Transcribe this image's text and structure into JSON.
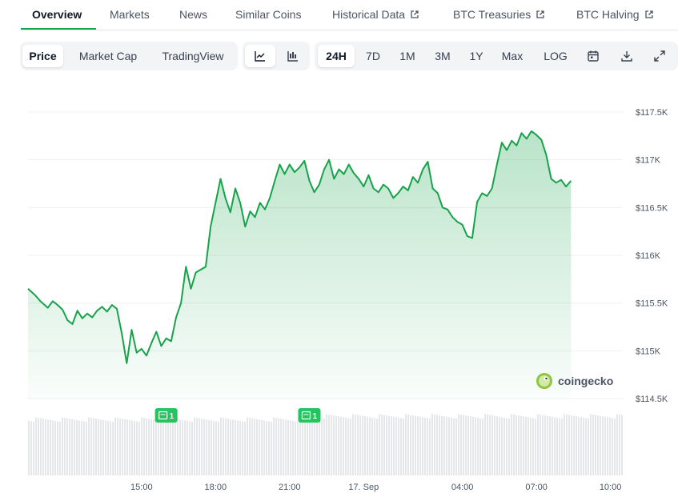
{
  "nav": {
    "tabs": [
      {
        "label": "Overview",
        "active": true
      },
      {
        "label": "Markets"
      },
      {
        "label": "News"
      },
      {
        "label": "Similar Coins"
      },
      {
        "label": "Historical Data",
        "external": true
      },
      {
        "label": "BTC Treasuries",
        "external": true
      },
      {
        "label": "BTC Halving",
        "external": true
      }
    ]
  },
  "toolbar": {
    "metric_buttons": [
      {
        "label": "Price",
        "selected": true
      },
      {
        "label": "Market Cap"
      },
      {
        "label": "TradingView"
      }
    ],
    "chart_type_icons": [
      "line-chart-icon",
      "candlestick-chart-icon"
    ],
    "range_buttons": [
      {
        "label": "24H",
        "selected": true
      },
      {
        "label": "7D"
      },
      {
        "label": "1M"
      },
      {
        "label": "3M"
      },
      {
        "label": "1Y"
      },
      {
        "label": "Max"
      },
      {
        "label": "LOG"
      }
    ],
    "action_icons": [
      "calendar-icon",
      "download-icon",
      "fullscreen-icon"
    ]
  },
  "watermark": "coingecko",
  "colors": {
    "accent": "#16a34a",
    "line": "#16a34a",
    "badge": "#22c55e",
    "volume": "#e5e7eb"
  },
  "chart_data": {
    "type": "area",
    "xlabel": "",
    "ylabel": "",
    "yticks": [
      "$114.5K",
      "$115K",
      "$115.5K",
      "$116K",
      "$116.5K",
      "$117K",
      "$117.5K"
    ],
    "ylim": [
      114500,
      117500
    ],
    "xticks": [
      "15:00",
      "18:00",
      "21:00",
      "17. Sep",
      "04:00",
      "07:00",
      "10:00"
    ],
    "xtick_hours": [
      15,
      18,
      21,
      24,
      28,
      31,
      34
    ],
    "xlim_hours": [
      10.4,
      34.5
    ],
    "grid": true,
    "legend": "none",
    "price_points": [
      [
        10.4,
        115650
      ],
      [
        10.7,
        115580
      ],
      [
        10.9,
        115520
      ],
      [
        11.2,
        115450
      ],
      [
        11.4,
        115520
      ],
      [
        11.6,
        115480
      ],
      [
        11.8,
        115430
      ],
      [
        12.0,
        115320
      ],
      [
        12.2,
        115280
      ],
      [
        12.4,
        115420
      ],
      [
        12.6,
        115340
      ],
      [
        12.8,
        115390
      ],
      [
        13.0,
        115350
      ],
      [
        13.2,
        115420
      ],
      [
        13.4,
        115460
      ],
      [
        13.6,
        115410
      ],
      [
        13.8,
        115480
      ],
      [
        14.0,
        115440
      ],
      [
        14.2,
        115180
      ],
      [
        14.4,
        114870
      ],
      [
        14.6,
        115220
      ],
      [
        14.8,
        114980
      ],
      [
        15.0,
        115020
      ],
      [
        15.2,
        114950
      ],
      [
        15.4,
        115080
      ],
      [
        15.6,
        115200
      ],
      [
        15.8,
        115050
      ],
      [
        16.0,
        115130
      ],
      [
        16.2,
        115100
      ],
      [
        16.4,
        115350
      ],
      [
        16.6,
        115500
      ],
      [
        16.8,
        115880
      ],
      [
        17.0,
        115650
      ],
      [
        17.2,
        115820
      ],
      [
        17.4,
        115850
      ],
      [
        17.6,
        115880
      ],
      [
        17.8,
        116300
      ],
      [
        18.0,
        116550
      ],
      [
        18.2,
        116800
      ],
      [
        18.4,
        116600
      ],
      [
        18.6,
        116450
      ],
      [
        18.8,
        116700
      ],
      [
        19.0,
        116550
      ],
      [
        19.2,
        116300
      ],
      [
        19.4,
        116460
      ],
      [
        19.6,
        116400
      ],
      [
        19.8,
        116550
      ],
      [
        20.0,
        116480
      ],
      [
        20.2,
        116600
      ],
      [
        20.4,
        116780
      ],
      [
        20.6,
        116950
      ],
      [
        20.8,
        116850
      ],
      [
        21.0,
        116950
      ],
      [
        21.2,
        116870
      ],
      [
        21.4,
        116920
      ],
      [
        21.6,
        116990
      ],
      [
        21.8,
        116780
      ],
      [
        22.0,
        116660
      ],
      [
        22.2,
        116740
      ],
      [
        22.4,
        116900
      ],
      [
        22.6,
        117000
      ],
      [
        22.8,
        116800
      ],
      [
        23.0,
        116900
      ],
      [
        23.2,
        116850
      ],
      [
        23.4,
        116950
      ],
      [
        23.6,
        116860
      ],
      [
        23.8,
        116800
      ],
      [
        24.0,
        116720
      ],
      [
        24.2,
        116840
      ],
      [
        24.4,
        116700
      ],
      [
        24.6,
        116660
      ],
      [
        24.8,
        116740
      ],
      [
        25.0,
        116700
      ],
      [
        25.2,
        116600
      ],
      [
        25.4,
        116650
      ],
      [
        25.6,
        116720
      ],
      [
        25.8,
        116680
      ],
      [
        26.0,
        116820
      ],
      [
        26.2,
        116760
      ],
      [
        26.4,
        116900
      ],
      [
        26.6,
        116980
      ],
      [
        26.8,
        116700
      ],
      [
        27.0,
        116650
      ],
      [
        27.2,
        116500
      ],
      [
        27.4,
        116480
      ],
      [
        27.6,
        116400
      ],
      [
        27.8,
        116350
      ],
      [
        28.0,
        116320
      ],
      [
        28.2,
        116200
      ],
      [
        28.4,
        116180
      ],
      [
        28.6,
        116560
      ],
      [
        28.8,
        116650
      ],
      [
        29.0,
        116620
      ],
      [
        29.2,
        116700
      ],
      [
        29.4,
        116950
      ],
      [
        29.6,
        117180
      ],
      [
        29.8,
        117100
      ],
      [
        30.0,
        117200
      ],
      [
        30.2,
        117150
      ],
      [
        30.4,
        117280
      ],
      [
        30.6,
        117220
      ],
      [
        30.8,
        117300
      ],
      [
        31.0,
        117260
      ],
      [
        31.2,
        117210
      ],
      [
        31.4,
        117050
      ],
      [
        31.6,
        116800
      ],
      [
        31.8,
        116760
      ],
      [
        32.0,
        116790
      ],
      [
        32.2,
        116720
      ],
      [
        32.4,
        116780
      ]
    ],
    "volume_level": 0.85,
    "news_badges": [
      {
        "hour": 16.0,
        "label": "1"
      },
      {
        "hour": 21.8,
        "label": "1"
      }
    ]
  }
}
